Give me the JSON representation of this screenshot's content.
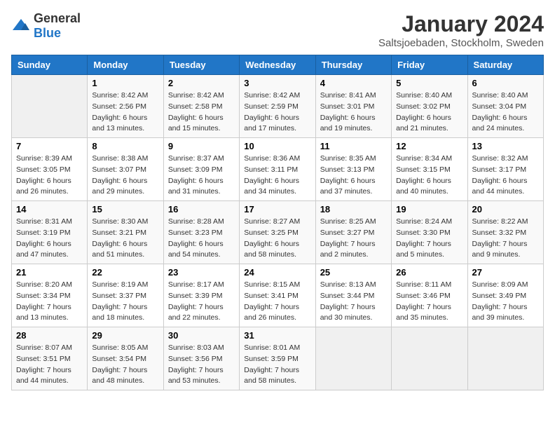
{
  "header": {
    "logo_general": "General",
    "logo_blue": "Blue",
    "month_year": "January 2024",
    "location": "Saltsjoebaden, Stockholm, Sweden"
  },
  "weekdays": [
    "Sunday",
    "Monday",
    "Tuesday",
    "Wednesday",
    "Thursday",
    "Friday",
    "Saturday"
  ],
  "weeks": [
    [
      {
        "day": "",
        "info": ""
      },
      {
        "day": "1",
        "info": "Sunrise: 8:42 AM\nSunset: 2:56 PM\nDaylight: 6 hours\nand 13 minutes."
      },
      {
        "day": "2",
        "info": "Sunrise: 8:42 AM\nSunset: 2:58 PM\nDaylight: 6 hours\nand 15 minutes."
      },
      {
        "day": "3",
        "info": "Sunrise: 8:42 AM\nSunset: 2:59 PM\nDaylight: 6 hours\nand 17 minutes."
      },
      {
        "day": "4",
        "info": "Sunrise: 8:41 AM\nSunset: 3:01 PM\nDaylight: 6 hours\nand 19 minutes."
      },
      {
        "day": "5",
        "info": "Sunrise: 8:40 AM\nSunset: 3:02 PM\nDaylight: 6 hours\nand 21 minutes."
      },
      {
        "day": "6",
        "info": "Sunrise: 8:40 AM\nSunset: 3:04 PM\nDaylight: 6 hours\nand 24 minutes."
      }
    ],
    [
      {
        "day": "7",
        "info": "Sunrise: 8:39 AM\nSunset: 3:05 PM\nDaylight: 6 hours\nand 26 minutes."
      },
      {
        "day": "8",
        "info": "Sunrise: 8:38 AM\nSunset: 3:07 PM\nDaylight: 6 hours\nand 29 minutes."
      },
      {
        "day": "9",
        "info": "Sunrise: 8:37 AM\nSunset: 3:09 PM\nDaylight: 6 hours\nand 31 minutes."
      },
      {
        "day": "10",
        "info": "Sunrise: 8:36 AM\nSunset: 3:11 PM\nDaylight: 6 hours\nand 34 minutes."
      },
      {
        "day": "11",
        "info": "Sunrise: 8:35 AM\nSunset: 3:13 PM\nDaylight: 6 hours\nand 37 minutes."
      },
      {
        "day": "12",
        "info": "Sunrise: 8:34 AM\nSunset: 3:15 PM\nDaylight: 6 hours\nand 40 minutes."
      },
      {
        "day": "13",
        "info": "Sunrise: 8:32 AM\nSunset: 3:17 PM\nDaylight: 6 hours\nand 44 minutes."
      }
    ],
    [
      {
        "day": "14",
        "info": "Sunrise: 8:31 AM\nSunset: 3:19 PM\nDaylight: 6 hours\nand 47 minutes."
      },
      {
        "day": "15",
        "info": "Sunrise: 8:30 AM\nSunset: 3:21 PM\nDaylight: 6 hours\nand 51 minutes."
      },
      {
        "day": "16",
        "info": "Sunrise: 8:28 AM\nSunset: 3:23 PM\nDaylight: 6 hours\nand 54 minutes."
      },
      {
        "day": "17",
        "info": "Sunrise: 8:27 AM\nSunset: 3:25 PM\nDaylight: 6 hours\nand 58 minutes."
      },
      {
        "day": "18",
        "info": "Sunrise: 8:25 AM\nSunset: 3:27 PM\nDaylight: 7 hours\nand 2 minutes."
      },
      {
        "day": "19",
        "info": "Sunrise: 8:24 AM\nSunset: 3:30 PM\nDaylight: 7 hours\nand 5 minutes."
      },
      {
        "day": "20",
        "info": "Sunrise: 8:22 AM\nSunset: 3:32 PM\nDaylight: 7 hours\nand 9 minutes."
      }
    ],
    [
      {
        "day": "21",
        "info": "Sunrise: 8:20 AM\nSunset: 3:34 PM\nDaylight: 7 hours\nand 13 minutes."
      },
      {
        "day": "22",
        "info": "Sunrise: 8:19 AM\nSunset: 3:37 PM\nDaylight: 7 hours\nand 18 minutes."
      },
      {
        "day": "23",
        "info": "Sunrise: 8:17 AM\nSunset: 3:39 PM\nDaylight: 7 hours\nand 22 minutes."
      },
      {
        "day": "24",
        "info": "Sunrise: 8:15 AM\nSunset: 3:41 PM\nDaylight: 7 hours\nand 26 minutes."
      },
      {
        "day": "25",
        "info": "Sunrise: 8:13 AM\nSunset: 3:44 PM\nDaylight: 7 hours\nand 30 minutes."
      },
      {
        "day": "26",
        "info": "Sunrise: 8:11 AM\nSunset: 3:46 PM\nDaylight: 7 hours\nand 35 minutes."
      },
      {
        "day": "27",
        "info": "Sunrise: 8:09 AM\nSunset: 3:49 PM\nDaylight: 7 hours\nand 39 minutes."
      }
    ],
    [
      {
        "day": "28",
        "info": "Sunrise: 8:07 AM\nSunset: 3:51 PM\nDaylight: 7 hours\nand 44 minutes."
      },
      {
        "day": "29",
        "info": "Sunrise: 8:05 AM\nSunset: 3:54 PM\nDaylight: 7 hours\nand 48 minutes."
      },
      {
        "day": "30",
        "info": "Sunrise: 8:03 AM\nSunset: 3:56 PM\nDaylight: 7 hours\nand 53 minutes."
      },
      {
        "day": "31",
        "info": "Sunrise: 8:01 AM\nSunset: 3:59 PM\nDaylight: 7 hours\nand 58 minutes."
      },
      {
        "day": "",
        "info": ""
      },
      {
        "day": "",
        "info": ""
      },
      {
        "day": "",
        "info": ""
      }
    ]
  ]
}
